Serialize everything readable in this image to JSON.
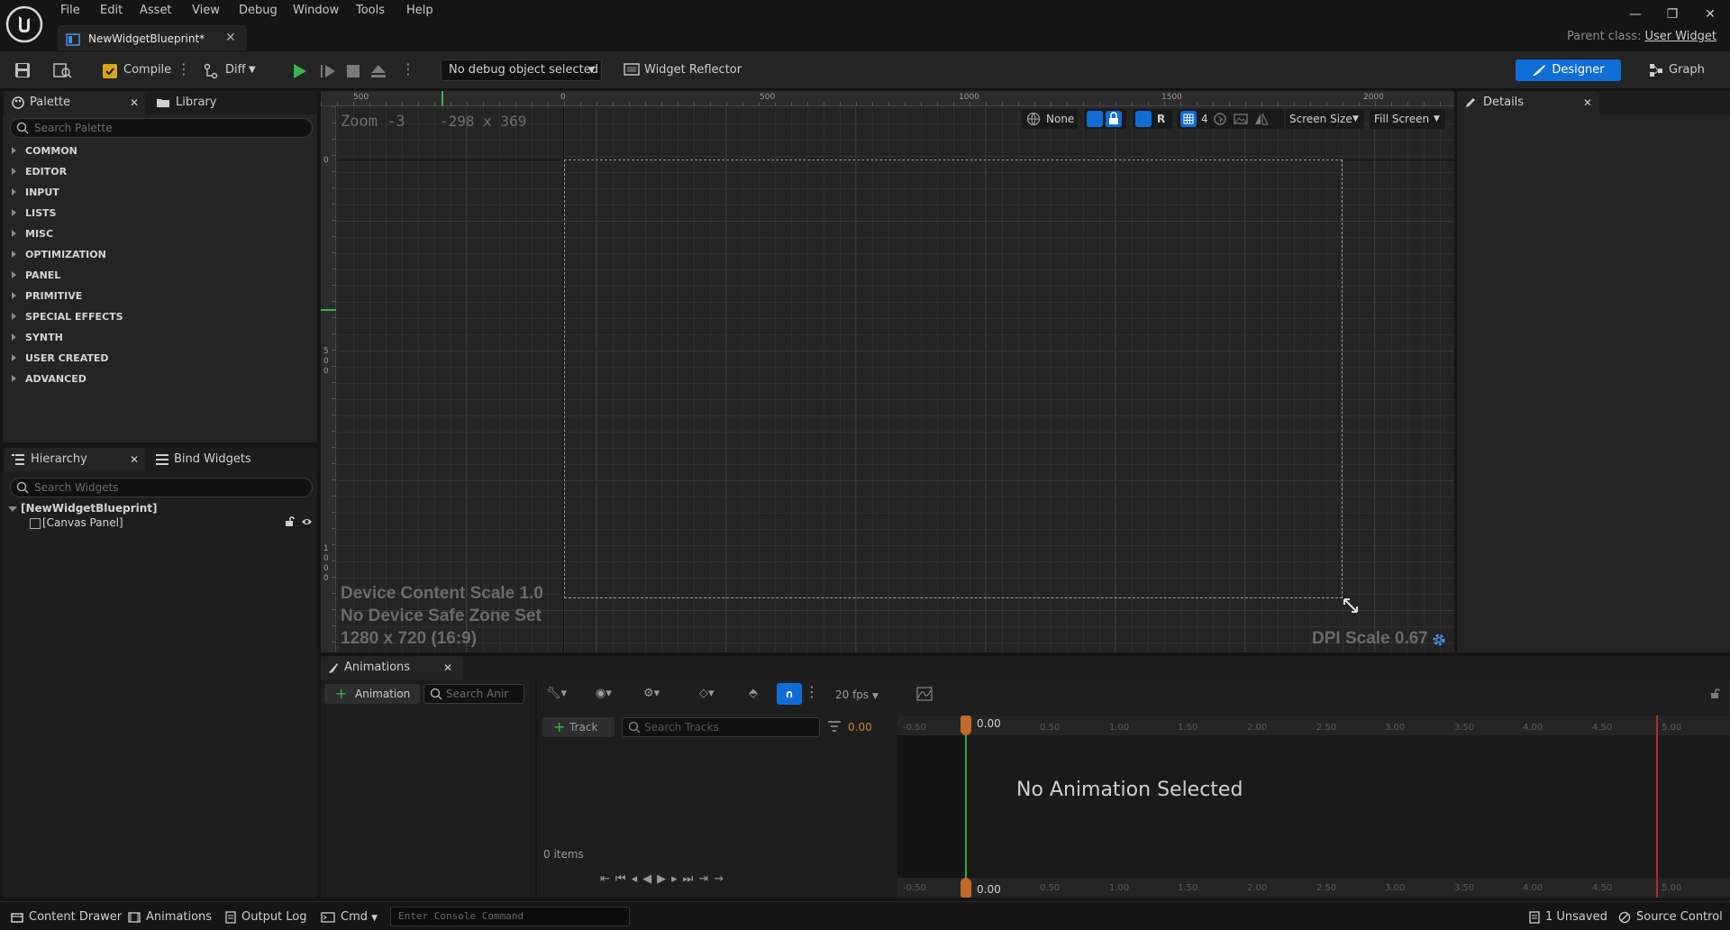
{
  "menu": [
    "File",
    "Edit",
    "Asset",
    "View",
    "Debug",
    "Window",
    "Tools",
    "Help"
  ],
  "document_tab": {
    "label": "NewWidgetBlueprint*"
  },
  "parent_class": {
    "label": "Parent class:",
    "value": "User Widget"
  },
  "toolbar": {
    "compile": "Compile",
    "diff": "Diff",
    "debug_object": "No debug object selected",
    "widget_reflector": "Widget Reflector",
    "designer": "Designer",
    "graph": "Graph"
  },
  "palette": {
    "tab": "Palette",
    "library_tab": "Library",
    "search_placeholder": "Search Palette",
    "categories": [
      "COMMON",
      "EDITOR",
      "INPUT",
      "LISTS",
      "MISC",
      "OPTIMIZATION",
      "PANEL",
      "PRIMITIVE",
      "SPECIAL EFFECTS",
      "SYNTH",
      "USER CREATED",
      "ADVANCED"
    ]
  },
  "hierarchy": {
    "tab": "Hierarchy",
    "bind_tab": "Bind Widgets",
    "search_placeholder": "Search Widgets",
    "root": "[NewWidgetBlueprint]",
    "child": "[Canvas Panel]"
  },
  "designer": {
    "zoom": "Zoom -3",
    "coords": "-298 x 369",
    "ruler_top": [
      "500",
      "0",
      "500",
      "1000",
      "1500",
      "2000"
    ],
    "ruler_left": [
      "0",
      "5\n0\n0",
      "1\n0\n0\n0"
    ],
    "localization": "None",
    "r_label": "R",
    "grid_size": "4",
    "screen_size": "Screen Size",
    "fill_screen": "Fill Screen",
    "info_line1": "Device Content Scale 1.0",
    "info_line2": "No Device Safe Zone Set",
    "info_line3": "1280 x 720 (16:9)",
    "dpi_scale": "DPI Scale 0.67"
  },
  "details": {
    "tab": "Details"
  },
  "animations": {
    "tab": "Animations",
    "add_animation": "Animation",
    "search_placeholder": "Search Anir",
    "fps": "20 fps",
    "add_track": "Track",
    "search_tracks_placeholder": "Search Tracks",
    "time_value": "0.00",
    "items_count": "0 items",
    "no_selection": "No Animation Selected",
    "playhead_top": "0.00",
    "playhead_bottom": "0.00",
    "timeline_labels": [
      "-0.50",
      "0.50",
      "1.00",
      "1.50",
      "2.00",
      "2.50",
      "3.00",
      "3.50",
      "4.00",
      "4.50",
      "5.00"
    ]
  },
  "statusbar": {
    "content_drawer": "Content Drawer",
    "animations": "Animations",
    "output_log": "Output Log",
    "cmd": "Cmd",
    "console_placeholder": "Enter Console Command",
    "unsaved": "1 Unsaved",
    "source_control": "Source Control"
  },
  "colors": {
    "accent": "#0e6ed6",
    "play_green": "#3cb24a",
    "playhead": "#c26a2a",
    "end_marker": "#b32a2a",
    "time_orange": "#c8862a"
  },
  "icons": [
    "unreal-logo-icon",
    "widget-blueprint-icon",
    "save-icon",
    "browse-icon",
    "compile-icon",
    "diff-icon",
    "play-icon",
    "step-icon",
    "stop-icon",
    "eject-icon",
    "widget-reflector-icon",
    "designer-icon",
    "graph-icon",
    "palette-icon",
    "library-icon",
    "hierarchy-icon",
    "bind-widgets-icon",
    "search-icon",
    "lock-icon",
    "eye-icon",
    "globe-icon",
    "grid-icon",
    "dpi-settings-icon",
    "resize-icon",
    "details-icon",
    "animation-icon",
    "filter-icon",
    "magnet-icon"
  ]
}
